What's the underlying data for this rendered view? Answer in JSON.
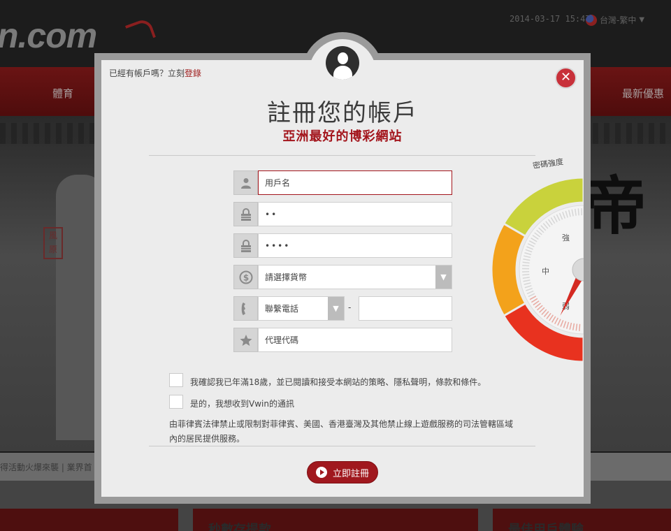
{
  "site": {
    "logo_text": "n.com",
    "date": "2014-03-17 15:47",
    "region": "台灣-繁中",
    "nav": {
      "sports": "體育",
      "promotions": "最新優惠"
    },
    "banner_ink": "帝",
    "seal": "風 原",
    "ticker": "得活動火爆來襲 | 業界首",
    "cards": [
      "",
      "秒數存提款",
      "最佳用戶體驗"
    ]
  },
  "modal": {
    "login_prompt": "已經有帳戶嗎？立刻",
    "login_link": "登錄",
    "close_label": "✕",
    "title": "註冊您的帳戶",
    "subtitle": "亞洲最好的博彩網站",
    "form": {
      "username_placeholder": "用戶名",
      "password_value": "••",
      "password_confirm_value": "••••",
      "currency_selected": "請選擇貨幣",
      "phone_code_selected": "聯繫電話",
      "phone_dash": "-",
      "agent_placeholder": "代理代碼"
    },
    "checkboxes": {
      "age_confirm": "我確認我已年滿18歲，並已閱讀和接受本網站的策略、隱私聲明，條款和條件。",
      "newsletter": "是的，我想收到Vwin的通訊"
    },
    "legal_notice": "由菲律賓法律禁止或限制對菲律賓、美國、香港臺灣及其他禁止線上遊戲服務的司法管轄區域內的居民提供服務。",
    "submit_label": "立即註冊",
    "strength": {
      "label": "密碼強度",
      "levels": [
        "強",
        "中",
        "弱"
      ],
      "level_value": 0.15,
      "colors": {
        "weak": "#e8321f",
        "medium": "#f3a21b",
        "strong": "#c9d23c"
      }
    }
  },
  "colors": {
    "accent": "#a3151c",
    "panel": "#ececec",
    "frame": "#9a9a9a"
  },
  "icons": [
    "user-icon",
    "lock-icon",
    "lock-icon",
    "currency-icon",
    "phone-icon",
    "star-icon",
    "close-icon",
    "play-icon",
    "chevron-down-icon"
  ]
}
